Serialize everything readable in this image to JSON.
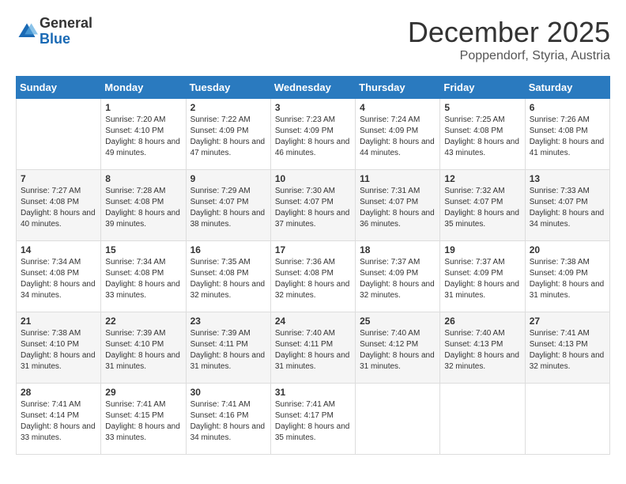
{
  "header": {
    "logo_general": "General",
    "logo_blue": "Blue",
    "month_title": "December 2025",
    "location": "Poppendorf, Styria, Austria"
  },
  "weekdays": [
    "Sunday",
    "Monday",
    "Tuesday",
    "Wednesday",
    "Thursday",
    "Friday",
    "Saturday"
  ],
  "weeks": [
    [
      {
        "day": "",
        "info": ""
      },
      {
        "day": "1",
        "info": "Sunrise: 7:20 AM\nSunset: 4:10 PM\nDaylight: 8 hours\nand 49 minutes."
      },
      {
        "day": "2",
        "info": "Sunrise: 7:22 AM\nSunset: 4:09 PM\nDaylight: 8 hours\nand 47 minutes."
      },
      {
        "day": "3",
        "info": "Sunrise: 7:23 AM\nSunset: 4:09 PM\nDaylight: 8 hours\nand 46 minutes."
      },
      {
        "day": "4",
        "info": "Sunrise: 7:24 AM\nSunset: 4:09 PM\nDaylight: 8 hours\nand 44 minutes."
      },
      {
        "day": "5",
        "info": "Sunrise: 7:25 AM\nSunset: 4:08 PM\nDaylight: 8 hours\nand 43 minutes."
      },
      {
        "day": "6",
        "info": "Sunrise: 7:26 AM\nSunset: 4:08 PM\nDaylight: 8 hours\nand 41 minutes."
      }
    ],
    [
      {
        "day": "7",
        "info": "Sunrise: 7:27 AM\nSunset: 4:08 PM\nDaylight: 8 hours\nand 40 minutes."
      },
      {
        "day": "8",
        "info": "Sunrise: 7:28 AM\nSunset: 4:08 PM\nDaylight: 8 hours\nand 39 minutes."
      },
      {
        "day": "9",
        "info": "Sunrise: 7:29 AM\nSunset: 4:07 PM\nDaylight: 8 hours\nand 38 minutes."
      },
      {
        "day": "10",
        "info": "Sunrise: 7:30 AM\nSunset: 4:07 PM\nDaylight: 8 hours\nand 37 minutes."
      },
      {
        "day": "11",
        "info": "Sunrise: 7:31 AM\nSunset: 4:07 PM\nDaylight: 8 hours\nand 36 minutes."
      },
      {
        "day": "12",
        "info": "Sunrise: 7:32 AM\nSunset: 4:07 PM\nDaylight: 8 hours\nand 35 minutes."
      },
      {
        "day": "13",
        "info": "Sunrise: 7:33 AM\nSunset: 4:07 PM\nDaylight: 8 hours\nand 34 minutes."
      }
    ],
    [
      {
        "day": "14",
        "info": "Sunrise: 7:34 AM\nSunset: 4:08 PM\nDaylight: 8 hours\nand 34 minutes."
      },
      {
        "day": "15",
        "info": "Sunrise: 7:34 AM\nSunset: 4:08 PM\nDaylight: 8 hours\nand 33 minutes."
      },
      {
        "day": "16",
        "info": "Sunrise: 7:35 AM\nSunset: 4:08 PM\nDaylight: 8 hours\nand 32 minutes."
      },
      {
        "day": "17",
        "info": "Sunrise: 7:36 AM\nSunset: 4:08 PM\nDaylight: 8 hours\nand 32 minutes."
      },
      {
        "day": "18",
        "info": "Sunrise: 7:37 AM\nSunset: 4:09 PM\nDaylight: 8 hours\nand 32 minutes."
      },
      {
        "day": "19",
        "info": "Sunrise: 7:37 AM\nSunset: 4:09 PM\nDaylight: 8 hours\nand 31 minutes."
      },
      {
        "day": "20",
        "info": "Sunrise: 7:38 AM\nSunset: 4:09 PM\nDaylight: 8 hours\nand 31 minutes."
      }
    ],
    [
      {
        "day": "21",
        "info": "Sunrise: 7:38 AM\nSunset: 4:10 PM\nDaylight: 8 hours\nand 31 minutes."
      },
      {
        "day": "22",
        "info": "Sunrise: 7:39 AM\nSunset: 4:10 PM\nDaylight: 8 hours\nand 31 minutes."
      },
      {
        "day": "23",
        "info": "Sunrise: 7:39 AM\nSunset: 4:11 PM\nDaylight: 8 hours\nand 31 minutes."
      },
      {
        "day": "24",
        "info": "Sunrise: 7:40 AM\nSunset: 4:11 PM\nDaylight: 8 hours\nand 31 minutes."
      },
      {
        "day": "25",
        "info": "Sunrise: 7:40 AM\nSunset: 4:12 PM\nDaylight: 8 hours\nand 31 minutes."
      },
      {
        "day": "26",
        "info": "Sunrise: 7:40 AM\nSunset: 4:13 PM\nDaylight: 8 hours\nand 32 minutes."
      },
      {
        "day": "27",
        "info": "Sunrise: 7:41 AM\nSunset: 4:13 PM\nDaylight: 8 hours\nand 32 minutes."
      }
    ],
    [
      {
        "day": "28",
        "info": "Sunrise: 7:41 AM\nSunset: 4:14 PM\nDaylight: 8 hours\nand 33 minutes."
      },
      {
        "day": "29",
        "info": "Sunrise: 7:41 AM\nSunset: 4:15 PM\nDaylight: 8 hours\nand 33 minutes."
      },
      {
        "day": "30",
        "info": "Sunrise: 7:41 AM\nSunset: 4:16 PM\nDaylight: 8 hours\nand 34 minutes."
      },
      {
        "day": "31",
        "info": "Sunrise: 7:41 AM\nSunset: 4:17 PM\nDaylight: 8 hours\nand 35 minutes."
      },
      {
        "day": "",
        "info": ""
      },
      {
        "day": "",
        "info": ""
      },
      {
        "day": "",
        "info": ""
      }
    ]
  ]
}
